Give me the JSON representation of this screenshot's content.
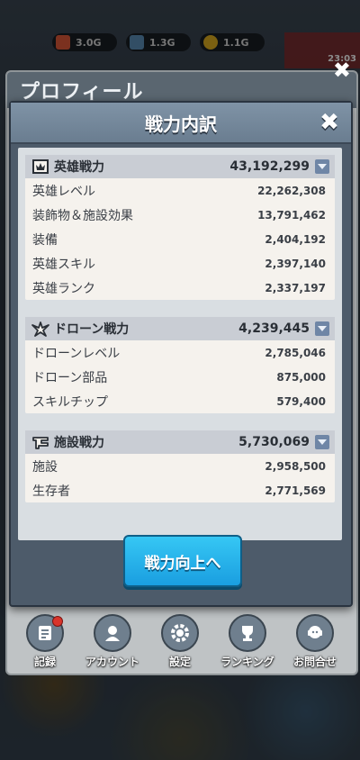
{
  "resources": [
    {
      "name": "gem-icon",
      "value": "3.0G",
      "color": "#e05a3a"
    },
    {
      "name": "steel-icon",
      "value": "1.3G",
      "color": "#5b8fb8"
    },
    {
      "name": "coin-icon",
      "value": "1.1G",
      "color": "#e0b020"
    }
  ],
  "shop_timer": "23:03",
  "profile": {
    "title": "プロフィール"
  },
  "modal": {
    "title": "戦力内訳",
    "close_label": "✖",
    "sections": [
      {
        "icon": "hero-icon",
        "title": "英雄戦力",
        "total": "43,192,299",
        "rows": [
          {
            "label": "英雄レベル",
            "value": "22,262,308"
          },
          {
            "label": "装飾物＆施設効果",
            "value": "13,791,462"
          },
          {
            "label": "装備",
            "value": "2,404,192"
          },
          {
            "label": "英雄スキル",
            "value": "2,397,140"
          },
          {
            "label": "英雄ランク",
            "value": "2,337,197"
          }
        ]
      },
      {
        "icon": "drone-icon",
        "title": "ドローン戦力",
        "total": "4,239,445",
        "rows": [
          {
            "label": "ドローンレベル",
            "value": "2,785,046"
          },
          {
            "label": "ドローン部品",
            "value": "875,000"
          },
          {
            "label": "スキルチップ",
            "value": "579,400"
          }
        ]
      },
      {
        "icon": "facility-icon",
        "title": "施設戦力",
        "total": "5,730,069",
        "rows": [
          {
            "label": "施設",
            "value": "2,958,500"
          },
          {
            "label": "生存者",
            "value": "2,771,569"
          }
        ]
      }
    ],
    "cta_label": "戦力向上へ"
  },
  "nav": [
    {
      "name": "nav-record",
      "icon": "record-icon",
      "label": "記録",
      "badge": true
    },
    {
      "name": "nav-account",
      "icon": "account-icon",
      "label": "アカウント",
      "badge": false
    },
    {
      "name": "nav-settings",
      "icon": "gear-icon",
      "label": "設定",
      "badge": false
    },
    {
      "name": "nav-ranking",
      "icon": "trophy-icon",
      "label": "ランキング",
      "badge": false
    },
    {
      "name": "nav-contact",
      "icon": "support-icon",
      "label": "お問合せ",
      "badge": false
    }
  ]
}
